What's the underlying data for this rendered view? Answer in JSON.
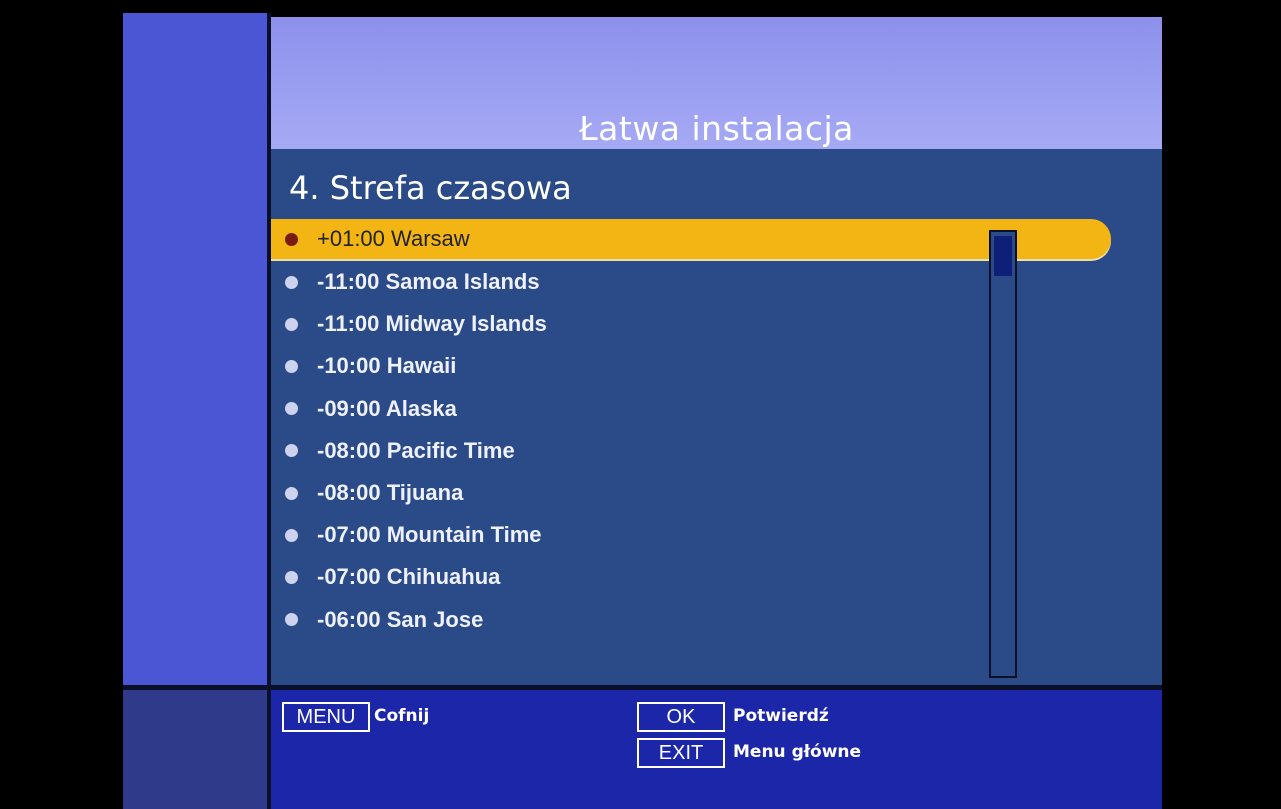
{
  "header": {
    "title": "Łatwa instalacja"
  },
  "section": {
    "title": "4. Strefa czasowa"
  },
  "timezones": [
    {
      "label": "+01:00 Warsaw"
    },
    {
      "label": "-11:00 Samoa Islands"
    },
    {
      "label": "-11:00 Midway Islands"
    },
    {
      "label": "-10:00 Hawaii"
    },
    {
      "label": "-09:00 Alaska"
    },
    {
      "label": "-08:00 Pacific Time"
    },
    {
      "label": "-08:00 Tijuana"
    },
    {
      "label": "-07:00 Mountain Time"
    },
    {
      "label": "-07:00 Chihuahua"
    },
    {
      "label": "-06:00 San Jose"
    }
  ],
  "selected_index": 0,
  "footer": {
    "menu_key": "MENU",
    "menu_label": "Cofnij",
    "ok_key": "OK",
    "ok_label": "Potwierdź",
    "exit_key": "EXIT",
    "exit_label": "Menu główne"
  },
  "colors": {
    "highlight": "#f2b513",
    "panel": "#2b4a88",
    "footer": "#1c26a8"
  }
}
